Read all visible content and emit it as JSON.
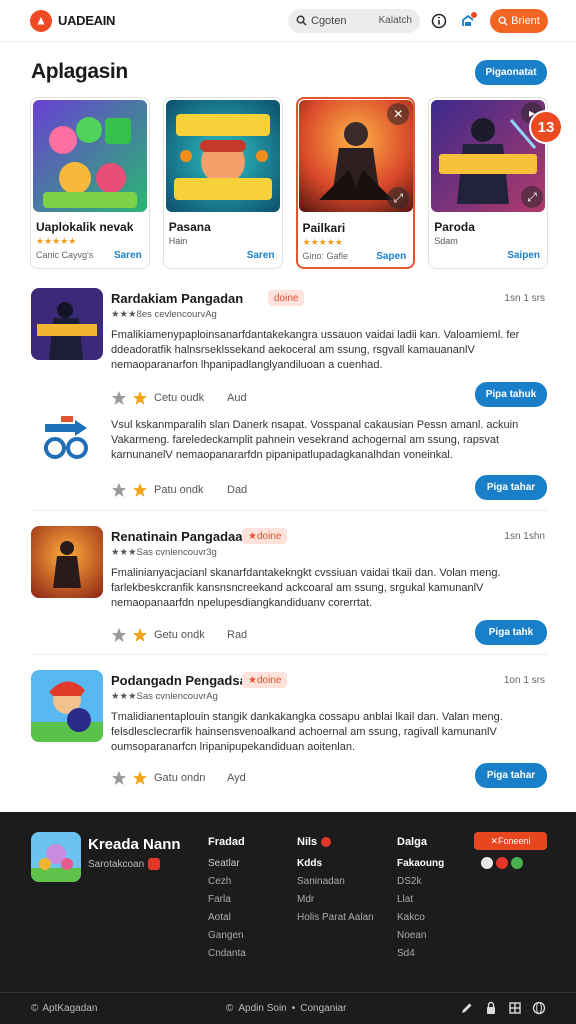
{
  "header": {
    "brand": "UADEAIN",
    "search_placeholder": "Cgoten",
    "search_shortcut": "Kalatch",
    "cta_label": "Brient"
  },
  "hero": {
    "title": "Aplagasin",
    "button": "Pigaonatat"
  },
  "cards": [
    {
      "title": "Uaplokalik nevak",
      "subtitle": "",
      "foot": "Canic Cayvg's",
      "link": "Saren",
      "rating": 5,
      "icon": "green-games-art"
    },
    {
      "title": "Pasana",
      "subtitle": "Hain",
      "foot": "",
      "link": "Saren",
      "rating": 0,
      "icon": "yellow-logo-art"
    },
    {
      "title": "Pailkari",
      "subtitle": "",
      "foot": "Gino: Gafle",
      "link": "Sapen",
      "rating": 5,
      "icon": "orange-warrior-art"
    },
    {
      "title": "Paroda",
      "subtitle": "Sdam",
      "foot": "",
      "link": "Saipen",
      "rating": 0,
      "icon": "purple-depiro-art",
      "badge": "13"
    }
  ],
  "list": [
    {
      "title": "Rardakiam Pangadan",
      "tag": "doine",
      "time": "1sn 1 srs",
      "meta": "★★★8es cevlencourvAg",
      "desc": "Fmalikiamenypaploinsanarfdantakekangra ussauon vaidai ladii kan. Valoamieml. fer ddeadoratfik halnsrseklssekand aekoceral am ssung, rsgvall kamauananlV nemaoparanarfon lhpanipadlanglyandiluoan a cuenhad.",
      "foot_label": "Cetu oudk",
      "foot_extra": "Aud",
      "button": "Pipa tahuk"
    },
    {
      "title": "",
      "tag": "",
      "time": "",
      "meta": "",
      "desc": "Vsul kskanmparalih slan Danerk nsapat. Vosspanal cakausian Pessn amanl. ackuin Vakarmeng. fareledeckamplit pahnein vesekrand achogernal am ssung, rapsvat karnunanelV nemaopanararfdn pipanipatlupadagkanalhdan voneinkal.",
      "foot_label": "Patu ondk",
      "foot_extra": "Dad",
      "button": "Piga tahar"
    },
    {
      "title": "Renatinain Pangadaa",
      "tag": "doine",
      "time": "1sn 1shn",
      "meta": "★★★Sas cvnlencouvr3g",
      "desc": "Fmalinianyacjacianl skanarfdantakekngkt cvssiuan vaidai tkaii dan. Volan meng. farlekbeskcranfik kansnsncreekand ackcoaral am ssung, srgukal kamunanlV nemaopanaarfdn npelupesdiangkandiduanv corerrtat.",
      "foot_label": "Getu ondk",
      "foot_extra": "Rad",
      "button": "Piga tahk"
    },
    {
      "title": "Podangadn Pengadsa",
      "tag": "doine",
      "time": "1on 1 srs",
      "meta": "★★★Sas cvnlencouvrAg",
      "desc": "Tmalidianentaplouin stangik dankakangka cossapu anblai lkail dan. Valan meng. felsdlesclecrarfik hainsensvenoalkand achoernal am ssung, ragivall kamunanlV oumsoparanarfcn lripanipupekandiduan aoitenlan.",
      "foot_label": "Gatu ondn",
      "foot_extra": "Ayd",
      "button": "Piga tahar"
    }
  ],
  "footer": {
    "brand": "Kreada Nann",
    "brand_sub": "Sarotakcoan",
    "col1": {
      "heading": "Fradad",
      "sub": "Seatlar",
      "links": [
        "Cezh",
        "Farla",
        "Aotal",
        "Gangen",
        "Cndanta"
      ]
    },
    "col2": {
      "heading": "Nils",
      "sub": "Kdds",
      "links": [
        "Saninadan",
        "Mdr",
        "Holis Parat Aalan"
      ]
    },
    "col3": {
      "heading": "Dalga",
      "sub": "Fakaoung",
      "links": [
        "DS2k",
        "Llat",
        "Kakco",
        "Noean",
        "Sd4"
      ]
    },
    "cta": "Foneeni",
    "copyright": "AptKagadan",
    "mid_left": "Apdin Soin",
    "mid_right": "Conganiar"
  },
  "colors": {
    "accent": "#f26522",
    "primary": "#1a7fc9",
    "tag_bg": "#fde3dc",
    "footer_bg": "#1c1c1c"
  }
}
